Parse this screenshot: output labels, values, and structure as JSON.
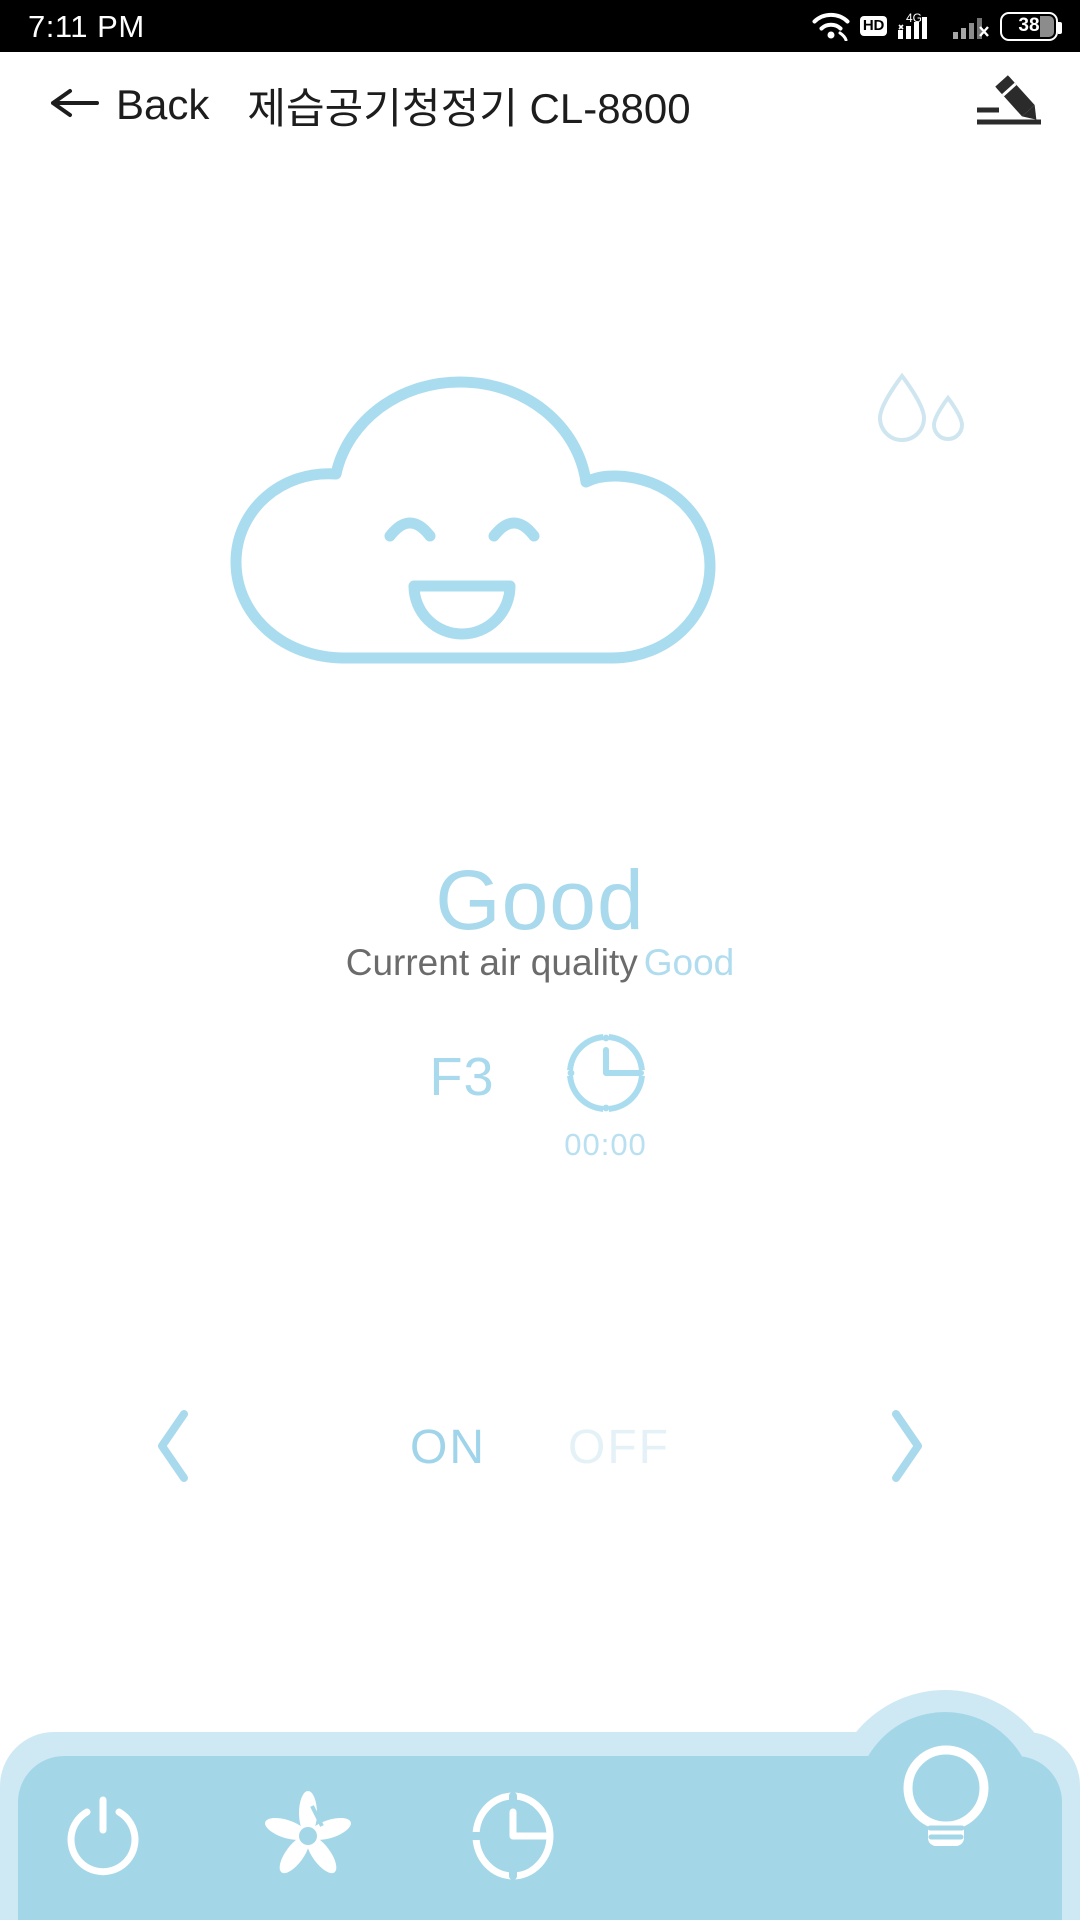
{
  "status_bar": {
    "time": "7:11 PM",
    "wifi_icon": "wifi-icon",
    "hd_label": "HD",
    "network_label": "4G",
    "signal_icon": "signal-bars-icon",
    "signal2_icon": "signal-bars-no-service-icon",
    "battery_level": "38"
  },
  "header": {
    "back_label": "Back",
    "title": "제습공기청정기 CL-8800",
    "back_icon": "arrow-left-icon",
    "edit_icon": "edit-pencil-icon"
  },
  "device": {
    "cloud_icon": "smiling-cloud-icon",
    "humidity_icon": "water-drops-icon",
    "quality_word": "Good",
    "quality_label": "Current air quality",
    "quality_value": "Good",
    "fan_speed": "F3",
    "timer_icon": "clock-icon",
    "timer_value": "00:00"
  },
  "power_selector": {
    "prev_icon": "chevron-left-icon",
    "next_icon": "chevron-right-icon",
    "on_label": "ON",
    "off_label": "OFF",
    "selected": "ON"
  },
  "bottom_bar": {
    "items": [
      {
        "name": "power-icon",
        "label": "power"
      },
      {
        "name": "fan-icon",
        "label": "fan"
      },
      {
        "name": "timer-icon",
        "label": "timer"
      }
    ],
    "light_icon": "lightbulb-icon"
  },
  "colors": {
    "accent": "#a9d9ec",
    "accent_soft": "#cfe9f4",
    "bar": "#a3d7e8",
    "inactive": "#e4f2f8",
    "text": "#1d1d1d",
    "muted": "#6b6b6b"
  }
}
